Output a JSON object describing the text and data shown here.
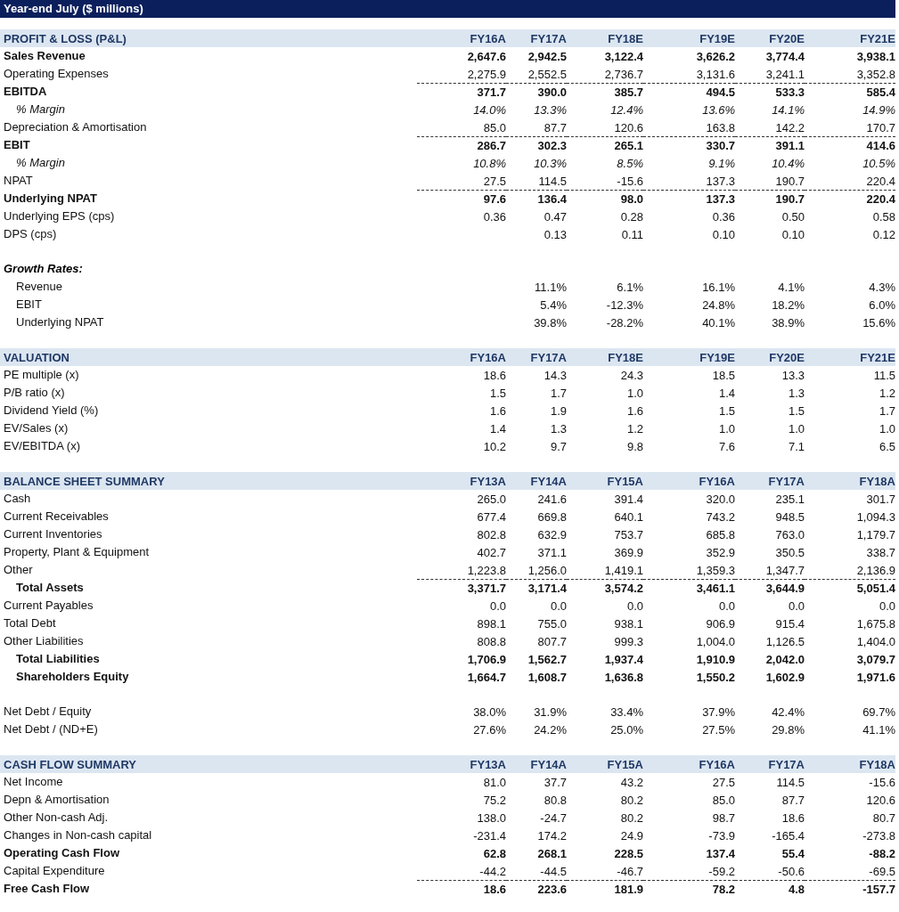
{
  "title": "Year-end July ($ millions)",
  "sections": [
    {
      "heading": {
        "kind": "band",
        "label": "PROFIT & LOSS (P&L)",
        "columns": [
          "FY16A",
          "FY17A",
          "FY18E",
          "FY19E",
          "FY20E",
          "FY21E"
        ]
      },
      "rows": [
        {
          "kind": "bold",
          "label": "Sales Revenue",
          "values": [
            "2,647.6",
            "2,942.5",
            "3,122.4",
            "3,626.2",
            "3,774.4",
            "3,938.1"
          ],
          "rule_above": false
        },
        {
          "kind": "plain",
          "label": "Operating Expenses",
          "values": [
            "2,275.9",
            "2,552.5",
            "2,736.7",
            "3,131.6",
            "3,241.1",
            "3,352.8"
          ],
          "rule_above": false
        },
        {
          "kind": "bold",
          "label": "EBITDA",
          "values": [
            "371.7",
            "390.0",
            "385.7",
            "494.5",
            "533.3",
            "585.4"
          ],
          "rule_above": true
        },
        {
          "kind": "italic",
          "label": "% Margin",
          "values": [
            "14.0%",
            "13.3%",
            "12.4%",
            "13.6%",
            "14.1%",
            "14.9%"
          ],
          "rule_above": false
        },
        {
          "kind": "plain",
          "label": "Depreciation & Amortisation",
          "values": [
            "85.0",
            "87.7",
            "120.6",
            "163.8",
            "142.2",
            "170.7"
          ],
          "rule_above": false
        },
        {
          "kind": "bold",
          "label": "EBIT",
          "values": [
            "286.7",
            "302.3",
            "265.1",
            "330.7",
            "391.1",
            "414.6"
          ],
          "rule_above": true
        },
        {
          "kind": "italic",
          "label": "% Margin",
          "values": [
            "10.8%",
            "10.3%",
            "8.5%",
            "9.1%",
            "10.4%",
            "10.5%"
          ],
          "rule_above": false
        },
        {
          "kind": "plain",
          "label": "NPAT",
          "values": [
            "27.5",
            "114.5",
            "-15.6",
            "137.3",
            "190.7",
            "220.4"
          ],
          "rule_above": false
        },
        {
          "kind": "bold",
          "label": "Underlying NPAT",
          "values": [
            "97.6",
            "136.4",
            "98.0",
            "137.3",
            "190.7",
            "220.4"
          ],
          "rule_above": true
        },
        {
          "kind": "plain",
          "label": "Underlying EPS (cps)",
          "values": [
            "0.36",
            "0.47",
            "0.28",
            "0.36",
            "0.50",
            "0.58"
          ],
          "rule_above": false
        },
        {
          "kind": "plain",
          "label": "DPS (cps)",
          "values": [
            "0.13",
            "0.11",
            "0.10",
            "0.10",
            "0.12"
          ],
          "rule_above": false
        }
      ]
    },
    {
      "heading": {
        "kind": "caption",
        "label": "Growth Rates:"
      },
      "rows": [
        {
          "kind": "indent",
          "label": "Revenue",
          "values": [
            "11.1%",
            "6.1%",
            "16.1%",
            "4.1%",
            "4.3%"
          ],
          "rule_above": false
        },
        {
          "kind": "indent",
          "label": "EBIT",
          "values": [
            "5.4%",
            "-12.3%",
            "24.8%",
            "18.2%",
            "6.0%"
          ],
          "rule_above": false
        },
        {
          "kind": "indent",
          "label": "Underlying NPAT",
          "values": [
            "39.8%",
            "-28.2%",
            "40.1%",
            "38.9%",
            "15.6%"
          ],
          "rule_above": false
        }
      ]
    },
    {
      "heading": {
        "kind": "band",
        "label": "VALUATION",
        "columns": [
          "FY16A",
          "FY17A",
          "FY18E",
          "FY19E",
          "FY20E",
          "FY21E"
        ]
      },
      "rows": [
        {
          "kind": "plain",
          "label": "PE multiple (x)",
          "values": [
            "18.6",
            "14.3",
            "24.3",
            "18.5",
            "13.3",
            "11.5"
          ],
          "rule_above": false
        },
        {
          "kind": "plain",
          "label": "P/B ratio (x)",
          "values": [
            "1.5",
            "1.7",
            "1.0",
            "1.4",
            "1.3",
            "1.2"
          ],
          "rule_above": false
        },
        {
          "kind": "plain",
          "label": "Dividend Yield (%)",
          "values": [
            "1.6",
            "1.9",
            "1.6",
            "1.5",
            "1.5",
            "1.7"
          ],
          "rule_above": false
        },
        {
          "kind": "plain",
          "label": "EV/Sales (x)",
          "values": [
            "1.4",
            "1.3",
            "1.2",
            "1.0",
            "1.0",
            "1.0"
          ],
          "rule_above": false
        },
        {
          "kind": "plain",
          "label": "EV/EBITDA (x)",
          "values": [
            "10.2",
            "9.7",
            "9.8",
            "7.6",
            "7.1",
            "6.5"
          ],
          "rule_above": false
        }
      ]
    },
    {
      "heading": {
        "kind": "band",
        "label": "BALANCE SHEET SUMMARY",
        "columns": [
          "FY13A",
          "FY14A",
          "FY15A",
          "FY16A",
          "FY17A",
          "FY18A"
        ]
      },
      "rows": [
        {
          "kind": "plain",
          "label": "Cash",
          "values": [
            "265.0",
            "241.6",
            "391.4",
            "320.0",
            "235.1",
            "301.7"
          ],
          "rule_above": false
        },
        {
          "kind": "plain",
          "label": "Current Receivables",
          "values": [
            "677.4",
            "669.8",
            "640.1",
            "743.2",
            "948.5",
            "1,094.3"
          ],
          "rule_above": false
        },
        {
          "kind": "plain",
          "label": "Current Inventories",
          "values": [
            "802.8",
            "632.9",
            "753.7",
            "685.8",
            "763.0",
            "1,179.7"
          ],
          "rule_above": false
        },
        {
          "kind": "plain",
          "label": "Property, Plant & Equipment",
          "values": [
            "402.7",
            "371.1",
            "369.9",
            "352.9",
            "350.5",
            "338.7"
          ],
          "rule_above": false
        },
        {
          "kind": "plain",
          "label": "Other",
          "values": [
            "1,223.8",
            "1,256.0",
            "1,419.1",
            "1,359.3",
            "1,347.7",
            "2,136.9"
          ],
          "rule_above": false
        },
        {
          "kind": "total",
          "label": "Total Assets",
          "values": [
            "3,371.7",
            "3,171.4",
            "3,574.2",
            "3,461.1",
            "3,644.9",
            "5,051.4"
          ],
          "rule_above": true
        },
        {
          "kind": "plain",
          "label": "Current Payables",
          "values": [
            "0.0",
            "0.0",
            "0.0",
            "0.0",
            "0.0",
            "0.0"
          ],
          "rule_above": false
        },
        {
          "kind": "plain",
          "label": "Total Debt",
          "values": [
            "898.1",
            "755.0",
            "938.1",
            "906.9",
            "915.4",
            "1,675.8"
          ],
          "rule_above": false
        },
        {
          "kind": "plain",
          "label": "Other Liabilities",
          "values": [
            "808.8",
            "807.7",
            "999.3",
            "1,004.0",
            "1,126.5",
            "1,404.0"
          ],
          "rule_above": false
        },
        {
          "kind": "total",
          "label": "Total Liabilities",
          "values": [
            "1,706.9",
            "1,562.7",
            "1,937.4",
            "1,910.9",
            "2,042.0",
            "3,079.7"
          ],
          "rule_above": false
        },
        {
          "kind": "total",
          "label": "Shareholders Equity",
          "values": [
            "1,664.7",
            "1,608.7",
            "1,636.8",
            "1,550.2",
            "1,602.9",
            "1,971.6"
          ],
          "rule_above": false
        }
      ]
    },
    {
      "rows": [
        {
          "kind": "plain",
          "label": "Net Debt / Equity",
          "values": [
            "38.0%",
            "31.9%",
            "33.4%",
            "37.9%",
            "42.4%",
            "69.7%"
          ],
          "rule_above": false
        },
        {
          "kind": "plain",
          "label": "Net Debt / (ND+E)",
          "values": [
            "27.6%",
            "24.2%",
            "25.0%",
            "27.5%",
            "29.8%",
            "41.1%"
          ],
          "rule_above": false
        }
      ]
    },
    {
      "heading": {
        "kind": "band",
        "label": "CASH FLOW SUMMARY",
        "columns": [
          "FY13A",
          "FY14A",
          "FY15A",
          "FY16A",
          "FY17A",
          "FY18A"
        ]
      },
      "rows": [
        {
          "kind": "plain",
          "label": "Net Income",
          "values": [
            "81.0",
            "37.7",
            "43.2",
            "27.5",
            "114.5",
            "-15.6"
          ],
          "rule_above": false
        },
        {
          "kind": "plain",
          "label": "Depn & Amortisation",
          "values": [
            "75.2",
            "80.8",
            "80.2",
            "85.0",
            "87.7",
            "120.6"
          ],
          "rule_above": false
        },
        {
          "kind": "plain",
          "label": "Other Non-cash Adj.",
          "values": [
            "138.0",
            "-24.7",
            "80.2",
            "98.7",
            "18.6",
            "80.7"
          ],
          "rule_above": false
        },
        {
          "kind": "plain",
          "label": "Changes in Non-cash capital",
          "values": [
            "-231.4",
            "174.2",
            "24.9",
            "-73.9",
            "-165.4",
            "-273.8"
          ],
          "rule_above": false
        },
        {
          "kind": "bold",
          "label": "Operating Cash Flow",
          "values": [
            "62.8",
            "268.1",
            "228.5",
            "137.4",
            "55.4",
            "-88.2"
          ],
          "rule_above": false
        },
        {
          "kind": "plain",
          "label": "Capital Expenditure",
          "values": [
            "-44.2",
            "-44.5",
            "-46.7",
            "-59.2",
            "-50.6",
            "-69.5"
          ],
          "rule_above": false
        },
        {
          "kind": "bold",
          "label": "Free Cash Flow",
          "values": [
            "18.6",
            "223.6",
            "181.9",
            "78.2",
            "4.8",
            "-157.7"
          ],
          "rule_above": true
        }
      ]
    }
  ]
}
